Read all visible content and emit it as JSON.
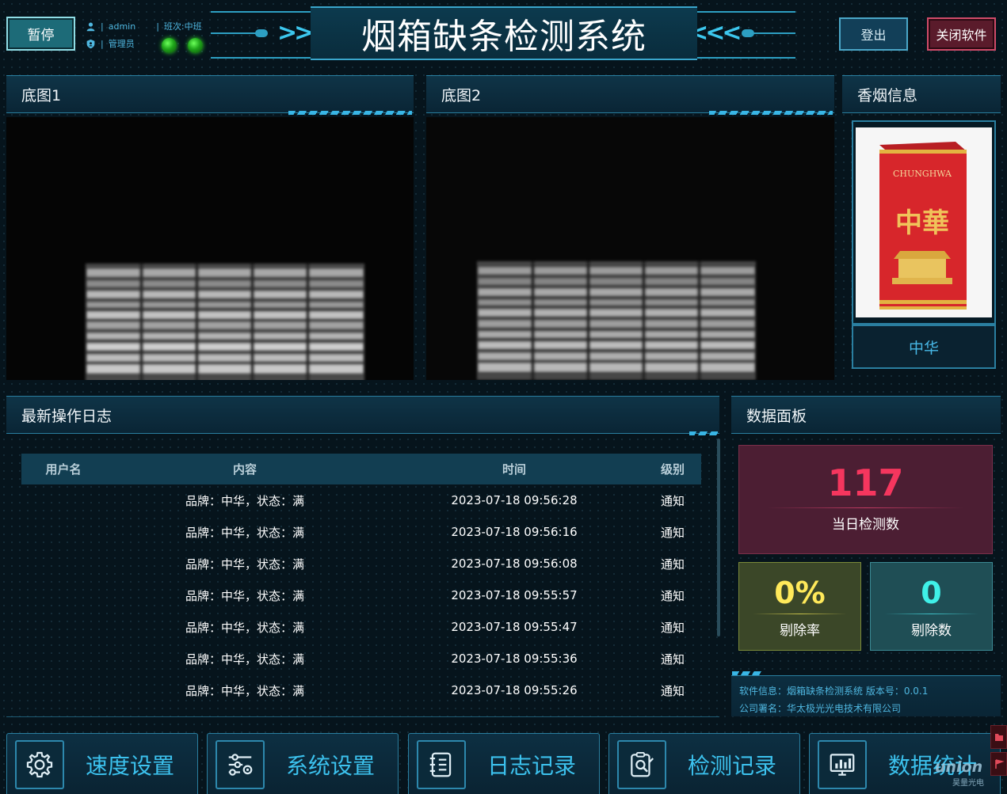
{
  "header": {
    "title": "烟箱缺条检测系统",
    "pause_label": "暂停",
    "user_name": "admin",
    "shift_label": "班次:中班",
    "role": "管理员",
    "logout_label": "登出",
    "close_label": "关闭软件"
  },
  "panels": {
    "cam1_title": "底图1",
    "cam2_title": "底图2",
    "cig_title": "香烟信息",
    "log_title": "最新操作日志",
    "data_title": "数据面板"
  },
  "cigarette": {
    "pack_brand_en": "CHUNGHWA",
    "pack_brand_cn": "中華",
    "name": "中华"
  },
  "log": {
    "columns": [
      "用户名",
      "内容",
      "时间",
      "级别"
    ],
    "rows": [
      {
        "user": "",
        "content": "品牌：中华，状态：满",
        "time": "2023-07-18 09:56:28",
        "level": "通知"
      },
      {
        "user": "",
        "content": "品牌：中华，状态：满",
        "time": "2023-07-18 09:56:16",
        "level": "通知"
      },
      {
        "user": "",
        "content": "品牌：中华，状态：满",
        "time": "2023-07-18 09:56:08",
        "level": "通知"
      },
      {
        "user": "",
        "content": "品牌：中华，状态：满",
        "time": "2023-07-18 09:55:57",
        "level": "通知"
      },
      {
        "user": "",
        "content": "品牌：中华，状态：满",
        "time": "2023-07-18 09:55:47",
        "level": "通知"
      },
      {
        "user": "",
        "content": "品牌：中华，状态：满",
        "time": "2023-07-18 09:55:36",
        "level": "通知"
      },
      {
        "user": "",
        "content": "品牌：中华，状态：满",
        "time": "2023-07-18 09:55:26",
        "level": "通知"
      }
    ]
  },
  "stats": {
    "daily_count": "117",
    "daily_count_label": "当日检测数",
    "reject_rate": "0%",
    "reject_rate_label": "剔除率",
    "reject_count": "0",
    "reject_count_label": "剔除数"
  },
  "software_info": {
    "line1": "软件信息：烟箱缺条检测系统   版本号：0.0.1",
    "line2": "公司署名：华太极光光电技术有限公司"
  },
  "nav": {
    "speed": "速度设置",
    "system": "系统设置",
    "log": "日志记录",
    "detect": "检测记录",
    "stats": "数据统计"
  },
  "watermark": {
    "text": "union",
    "sub": "昊量光电"
  },
  "colors": {
    "accent": "#39b6e6",
    "pause_bg": "#1d6b78",
    "close_bg": "#5a1b2b",
    "stat_red": "#f5365e",
    "stat_yellow": "#ffe95a",
    "stat_cyan": "#3ff0e8"
  },
  "icons": {
    "user": "user-icon",
    "shield": "shield-icon",
    "gear": "gear-icon",
    "sliders": "sliders-icon",
    "notebook": "notebook-icon",
    "clipboard": "clipboard-search-icon",
    "chart": "monitor-chart-icon"
  }
}
